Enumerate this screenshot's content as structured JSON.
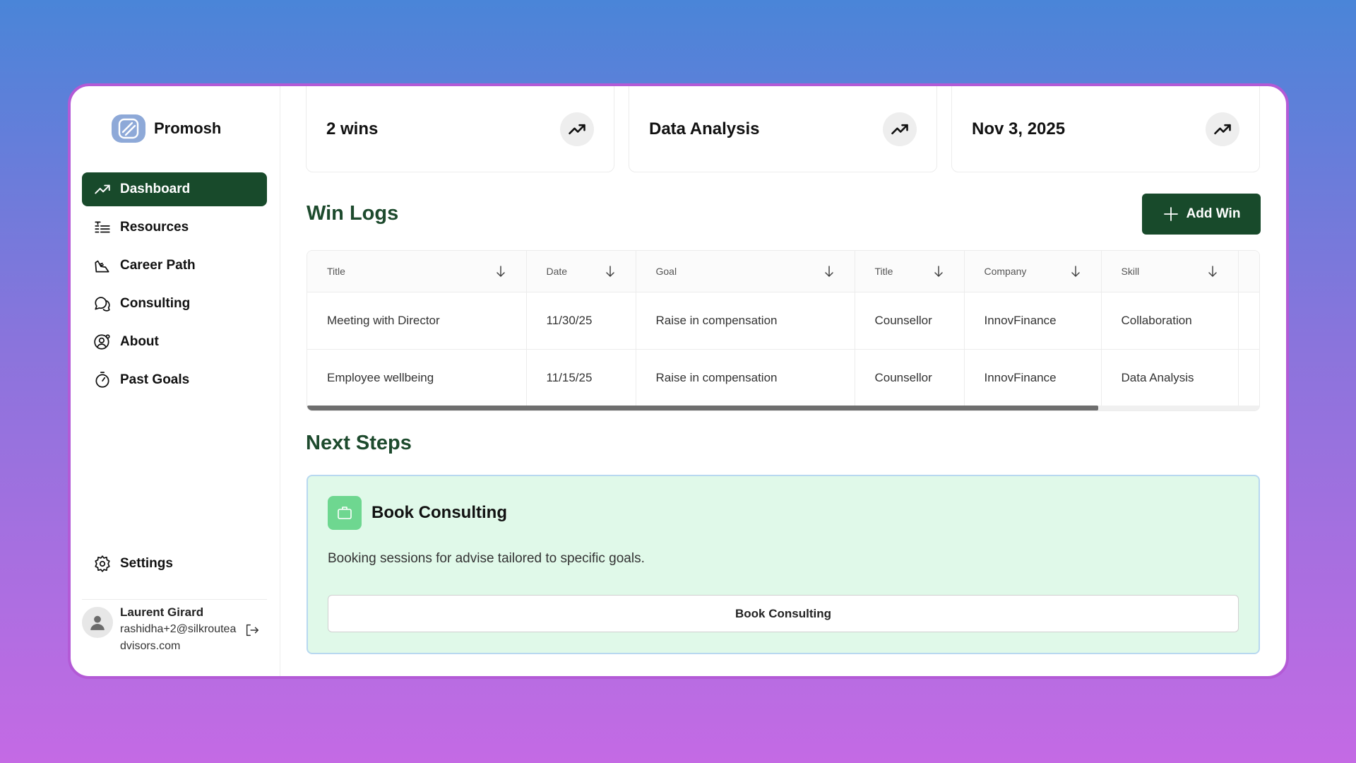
{
  "brand": {
    "name": "Promosh"
  },
  "sidebar": {
    "items": [
      {
        "label": "Dashboard",
        "icon": "trend-up-icon",
        "active": true
      },
      {
        "label": "Resources",
        "icon": "list-icon"
      },
      {
        "label": "Career Path",
        "icon": "footprint-icon"
      },
      {
        "label": "Consulting",
        "icon": "chat-bubbles-icon"
      },
      {
        "label": "About",
        "icon": "user-gear-icon"
      },
      {
        "label": "Past Goals",
        "icon": "stopwatch-icon"
      }
    ],
    "settings_label": "Settings"
  },
  "user": {
    "name": "Laurent Girard",
    "email": "rashidha+2@silkrouteadvisors.com"
  },
  "stats": [
    {
      "value": "2 wins"
    },
    {
      "value": "Data Analysis"
    },
    {
      "value": "Nov 3, 2025"
    }
  ],
  "win_logs": {
    "title": "Win Logs",
    "add_label": "Add Win",
    "columns": [
      "Title",
      "Date",
      "Goal",
      "Title",
      "Company",
      "Skill"
    ],
    "rows": [
      [
        "Meeting with Director",
        "11/30/25",
        "Raise in compensation",
        "Counsellor",
        "InnovFinance",
        "Collaboration"
      ],
      [
        "Employee wellbeing",
        "11/15/25",
        "Raise in compensation",
        "Counsellor",
        "InnovFinance",
        "Data Analysis"
      ]
    ]
  },
  "next_steps": {
    "title": "Next Steps",
    "card_title": "Book Consulting",
    "card_desc": "Booking sessions for advise tailored to specific goals.",
    "card_button": "Book Consulting"
  },
  "colors": {
    "accent": "#184a2b",
    "heading": "#1d4a2d",
    "card_bg": "#e0f9e9",
    "badge": "#6ed790"
  }
}
